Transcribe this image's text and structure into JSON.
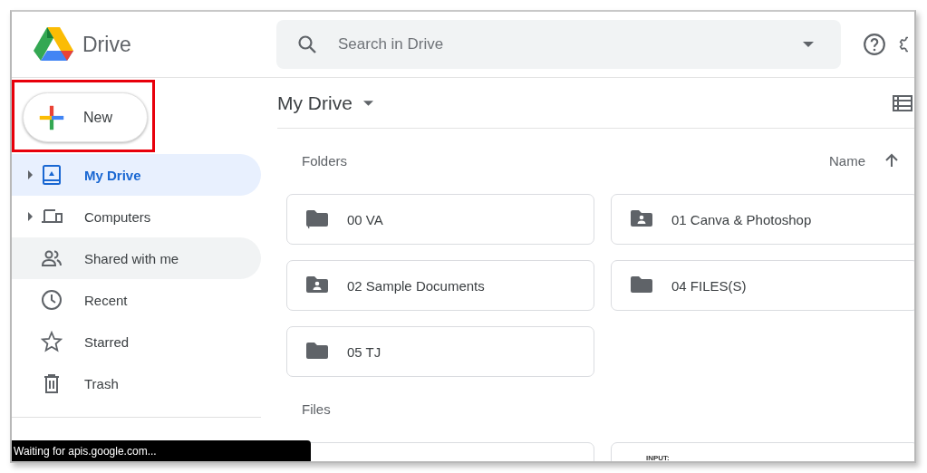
{
  "app": {
    "name": "Drive"
  },
  "search": {
    "placeholder": "Search in Drive"
  },
  "new_button": {
    "label": "New",
    "highlighted": true
  },
  "sidebar": {
    "items": [
      {
        "label": "My Drive",
        "expandable": true,
        "selected": true,
        "hovered": false
      },
      {
        "label": "Computers",
        "expandable": true,
        "selected": false,
        "hovered": false
      },
      {
        "label": "Shared with me",
        "expandable": false,
        "selected": false,
        "hovered": true
      },
      {
        "label": "Recent",
        "expandable": false,
        "selected": false,
        "hovered": false
      },
      {
        "label": "Starred",
        "expandable": false,
        "selected": false,
        "hovered": false
      },
      {
        "label": "Trash",
        "expandable": false,
        "selected": false,
        "hovered": false
      }
    ]
  },
  "main": {
    "title": "My Drive",
    "folders_heading": "Folders",
    "sort": {
      "label": "Name"
    },
    "files_heading": "Files"
  },
  "folders": [
    {
      "name": "00 VA",
      "kind": "shortcut"
    },
    {
      "name": "01 Canva & Photoshop",
      "kind": "shared"
    },
    {
      "name": "02 Sample Documents",
      "kind": "shared"
    },
    {
      "name": "04 FILES(S)",
      "kind": "plain"
    },
    {
      "name": "05 TJ",
      "kind": "plain"
    }
  ],
  "files": [
    {
      "kind": "blank"
    },
    {
      "kind": "document",
      "preview_text": "INPUT:"
    }
  ],
  "status_bar": {
    "text": "Waiting for apis.google.com..."
  }
}
